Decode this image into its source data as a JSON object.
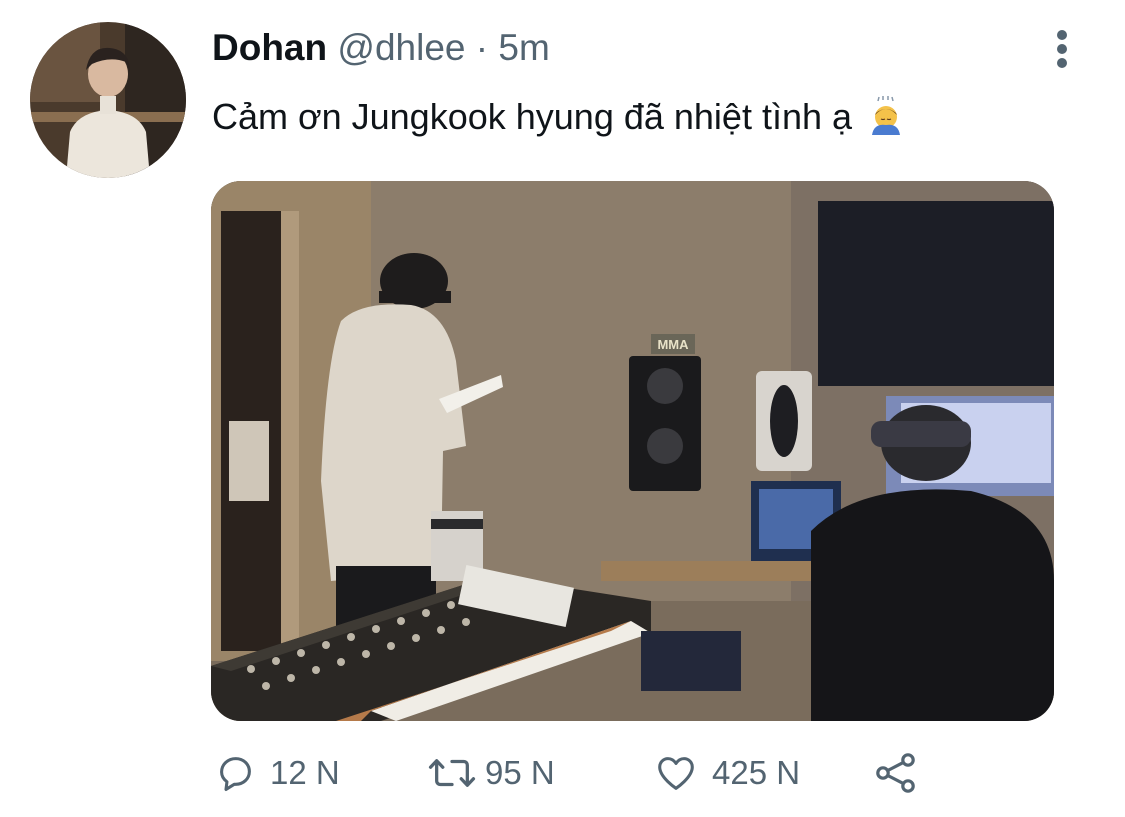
{
  "tweet": {
    "author_name": "Dohan",
    "author_handle": "@dhlee",
    "separator": "·",
    "time_ago": "5m",
    "text": "Cảm ơn Jungkook hyung đã nhiệt tình ạ",
    "text_emoji": "bowing-person-emoji",
    "media": {
      "visible_label": "MMA"
    }
  },
  "actions": {
    "reply": {
      "icon": "reply-icon",
      "count": "12 N"
    },
    "retweet": {
      "icon": "retweet-icon",
      "count": "95 N"
    },
    "like": {
      "icon": "heart-icon",
      "count": "425 N"
    },
    "share": {
      "icon": "share-icon"
    }
  },
  "colors": {
    "text_primary": "#0f1419",
    "text_secondary": "#536471",
    "background": "#ffffff"
  }
}
